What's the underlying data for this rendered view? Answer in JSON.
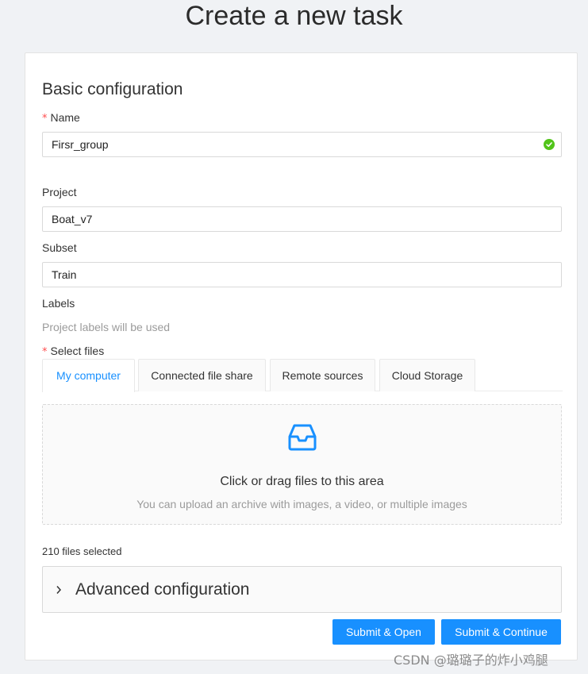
{
  "page": {
    "title": "Create a new task"
  },
  "form": {
    "section_title": "Basic configuration",
    "name": {
      "label": "Name",
      "value": "Firsr_group",
      "valid": true
    },
    "project": {
      "label": "Project",
      "value": "Boat_v7"
    },
    "subset": {
      "label": "Subset",
      "value": "Train"
    },
    "labels": {
      "label": "Labels",
      "hint": "Project labels will be used"
    },
    "select_files": {
      "label": "Select files",
      "tabs": [
        "My computer",
        "Connected file share",
        "Remote sources",
        "Cloud Storage"
      ],
      "active_tab": "My computer",
      "drop_text": "Click or drag files to this area",
      "drop_hint": "You can upload an archive with images, a video, or multiple images",
      "files_selected": "210 files selected"
    },
    "advanced": {
      "label": "Advanced configuration"
    },
    "buttons": {
      "submit_open": "Submit & Open",
      "submit_continue": "Submit & Continue"
    }
  },
  "watermark": "CSDN @璐璐子的炸小鸡腿",
  "icons": {
    "valid": "check-circle-icon",
    "dropzone": "inbox-icon",
    "collapse": "chevron-right-icon"
  },
  "colors": {
    "primary": "#1890ff",
    "success": "#52c41a",
    "required": "#ff4d4f"
  }
}
